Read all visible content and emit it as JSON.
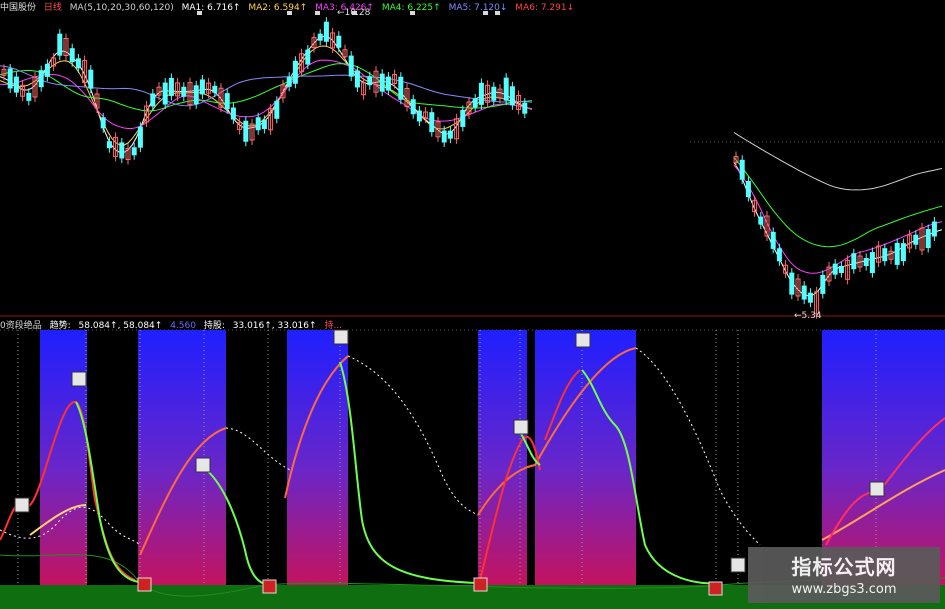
{
  "header": {
    "stock": "中国股份",
    "period": "日线",
    "ma_params": "MA(5,10,20,30,60,120)",
    "ma1": "MA1: 6.716↑",
    "ma2": "MA2: 6.594↑",
    "ma3": "MA3: 6.426↑",
    "ma4": "MA4: 6.225↑",
    "ma5": "MA5: 7.120↓",
    "ma6": "MA6: 7.291↓"
  },
  "price_panel": {
    "high_label": "←10.28",
    "low_label": "←5.34"
  },
  "indicator_header": {
    "name": "0资段绝品",
    "trend_label": "趋势:",
    "trend_value": "58.084↑, 58.084↑",
    "extra_value": "4.560",
    "hold_label": "持股:",
    "hold_value": "33.016↑, 33.016↑",
    "tail": "持..."
  },
  "watermark": {
    "title": "指标公式网",
    "url": "www.zbgs3.com"
  },
  "colors": {
    "ma1": "#ffffff",
    "ma2": "#ffd24a",
    "ma3": "#ff3cff",
    "ma4": "#33ff33",
    "ma5": "#8888ff",
    "ma6": "#ff4444",
    "up_candle": "#ff6a6a",
    "down_candle": "#54ffff",
    "band_top": "#1f1fff",
    "band_bottom": "#c4135f",
    "trend_line": "#ff5a3c",
    "hold_line": "#6cff4e",
    "bottom_bar": "#0f6e0f"
  }
}
